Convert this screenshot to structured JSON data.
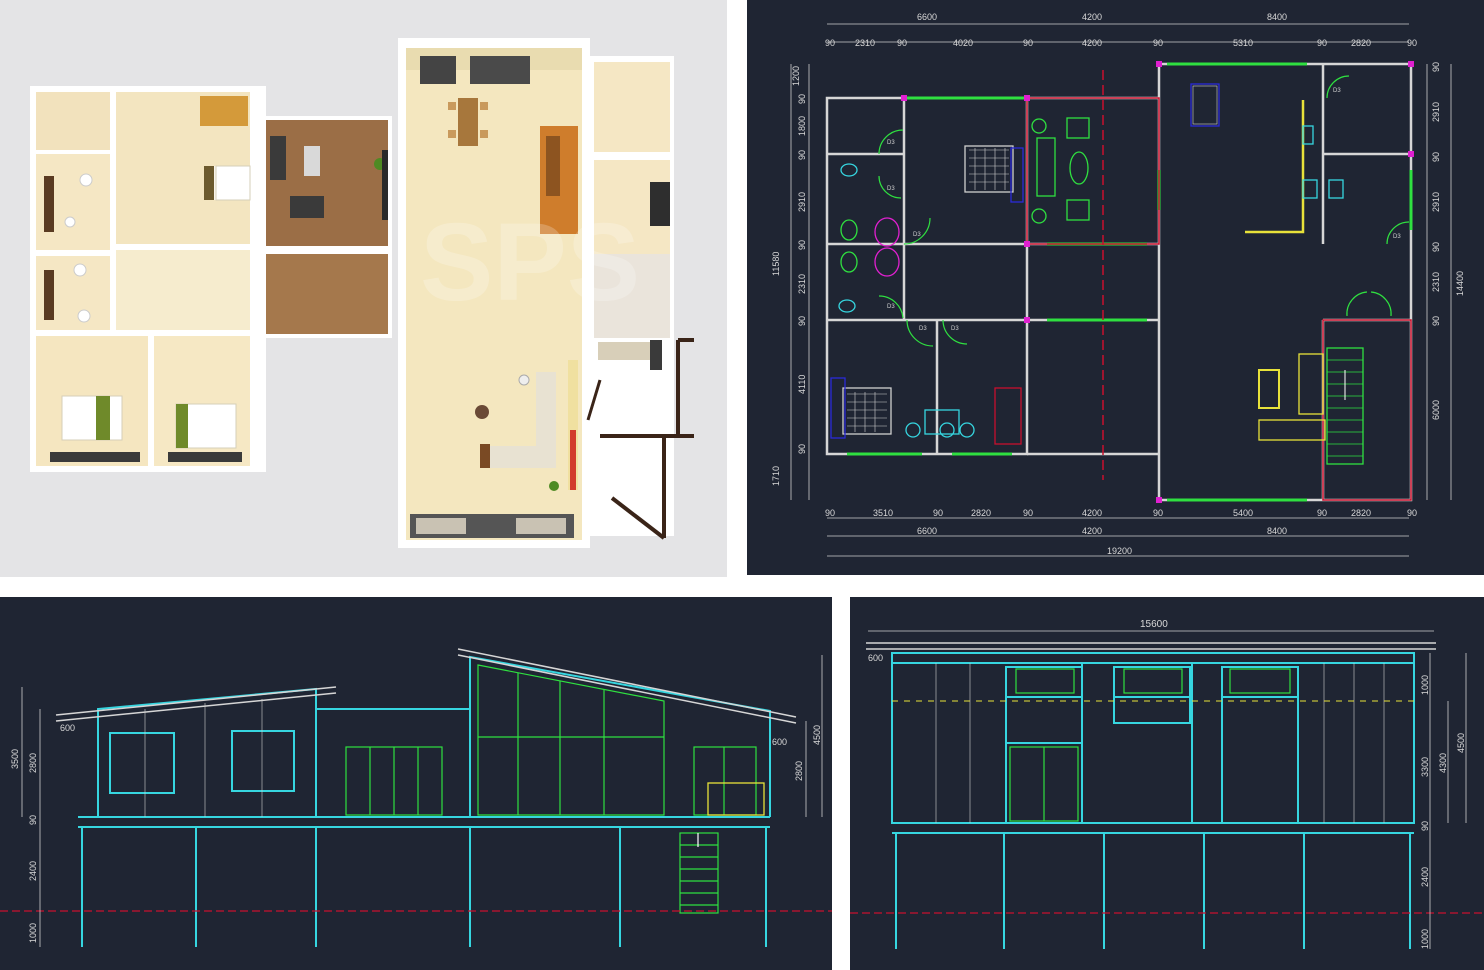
{
  "colors": {
    "cad_background": "#1f2533",
    "wall": "#d6d6d6",
    "cyan": "#36d6e0",
    "green": "#2fe040",
    "yellow": "#e8e23a",
    "magenta": "#e020d0",
    "red": "#c8102e",
    "render_bg": "#e4e4e6",
    "floor_light": "#f3e6bf",
    "floor_wood": "#9b6e46"
  },
  "render_panel": {
    "watermark": "SPS"
  },
  "floor_plan": {
    "top_dims_row1": [
      "6600",
      "4200",
      "8400"
    ],
    "top_dims_row2": [
      "90",
      "2310",
      "90",
      "4020",
      "90",
      "4200",
      "90",
      "5310",
      "90",
      "2820",
      "90"
    ],
    "bottom_dims_row1": [
      "90",
      "3510",
      "90",
      "2820",
      "90",
      "4200",
      "90",
      "5400",
      "90",
      "2820",
      "90"
    ],
    "bottom_dims_row2": [
      "6600",
      "4200",
      "8400"
    ],
    "bottom_total": "19200",
    "left_dims": [
      "1200",
      "90",
      "1800",
      "90",
      "2910",
      "90",
      "2310",
      "90",
      "4110",
      "90",
      "1710"
    ],
    "left_total": "11580",
    "right_dims": [
      "90",
      "2910",
      "90",
      "2910",
      "90",
      "2310",
      "90",
      "6000"
    ],
    "right_total": "14400",
    "door_tags": [
      "D3",
      "D3",
      "D3",
      "D3",
      "D3",
      "D3",
      "D3",
      "D3"
    ]
  },
  "elevation_front": {
    "left_dims": [
      "3500",
      "2800",
      "90",
      "2400",
      "1000"
    ],
    "right_dims": [
      "2800",
      "4500"
    ],
    "eave_left": "600",
    "eave_right": "600"
  },
  "elevation_side": {
    "top_dim": "15600",
    "eave": "600",
    "right_dims_inner": [
      "1000",
      "3300",
      "90",
      "2400",
      "1000"
    ],
    "right_dims_mid": "4300",
    "right_dims_outer": "4500"
  }
}
